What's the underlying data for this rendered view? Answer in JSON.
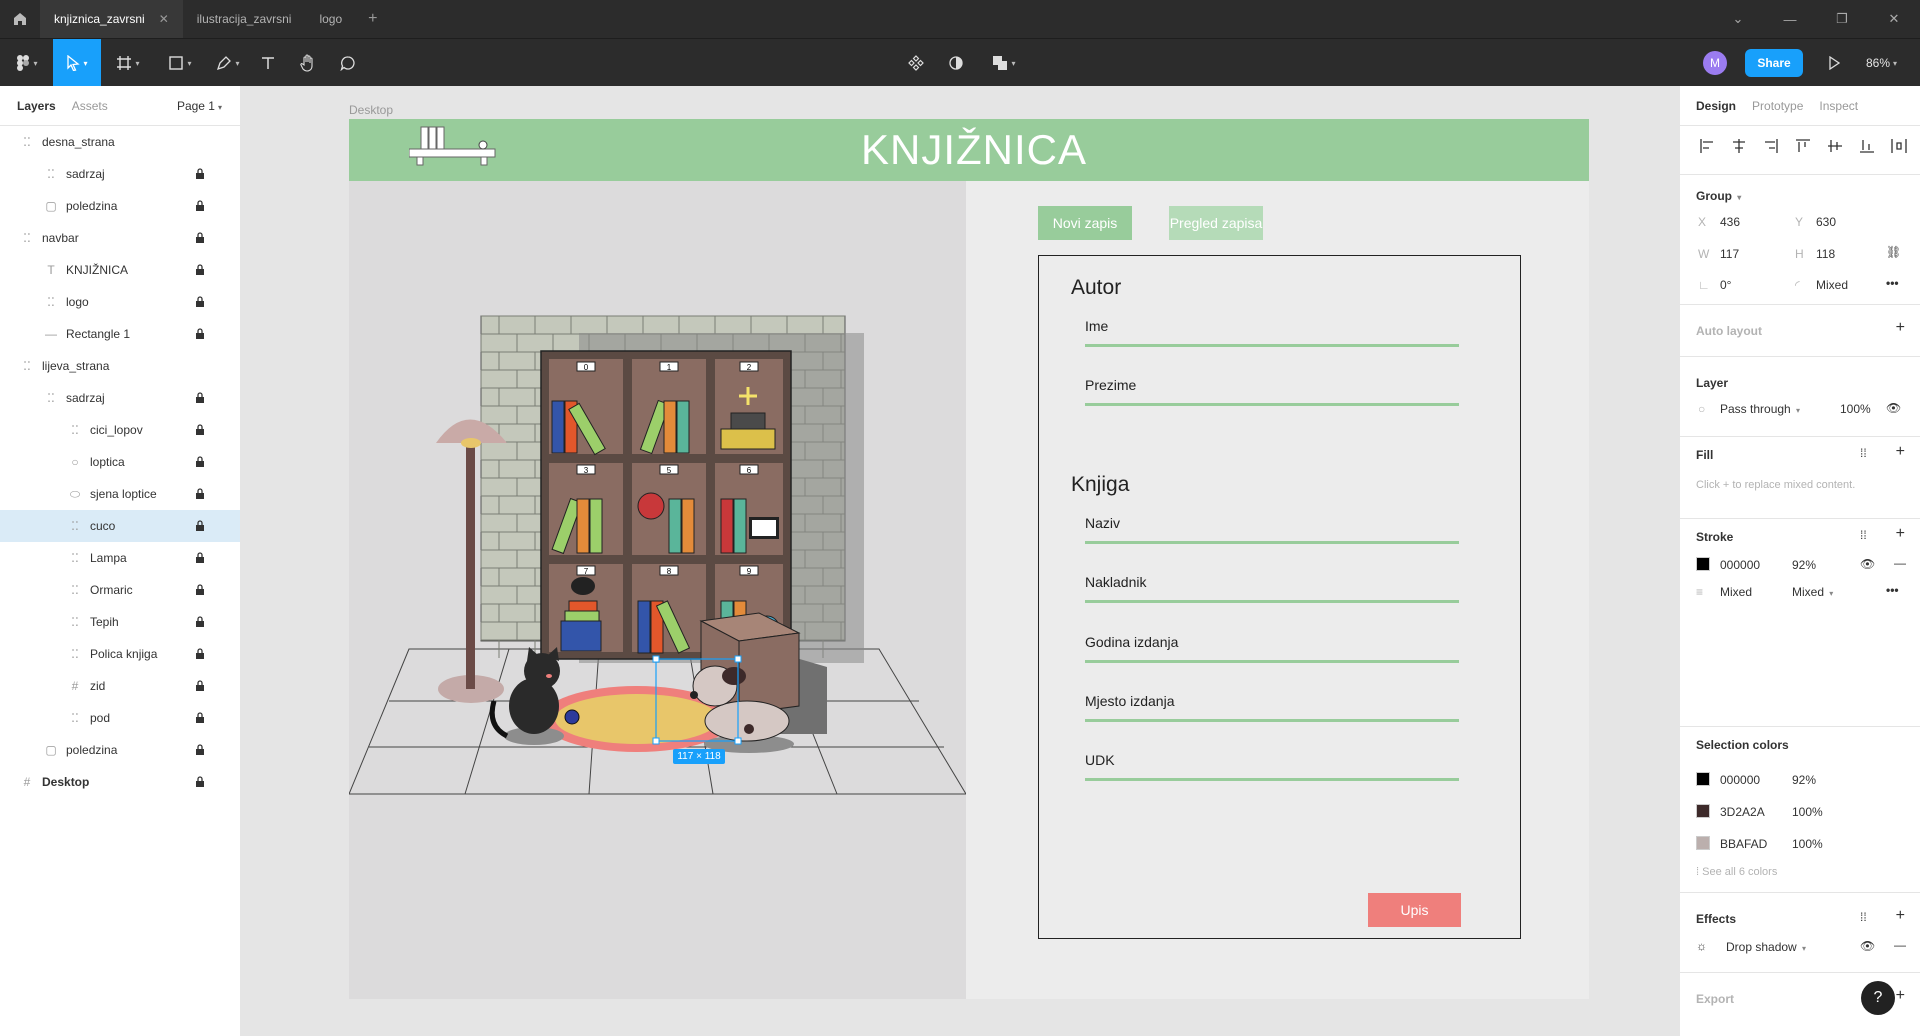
{
  "tabs": [
    {
      "label": "knjiznica_zavrsni",
      "active": true
    },
    {
      "label": "ilustracija_zavrsni",
      "active": false
    },
    {
      "label": "logo",
      "active": false
    }
  ],
  "toolbar": {
    "share_label": "Share",
    "zoom": "86%",
    "avatar_letter": "M"
  },
  "left_panel": {
    "tab_layers": "Layers",
    "tab_assets": "Assets",
    "page": "Page 1",
    "layers": [
      {
        "name": "desna_strana",
        "icon": "frame",
        "indent": 0,
        "locked": false
      },
      {
        "name": "sadrzaj",
        "icon": "frame",
        "indent": 1,
        "locked": true
      },
      {
        "name": "poledzina",
        "icon": "rect",
        "indent": 1,
        "locked": true
      },
      {
        "name": "navbar",
        "icon": "frame",
        "indent": 0,
        "locked": true
      },
      {
        "name": "KNJIŽNICA",
        "icon": "text",
        "indent": 1,
        "locked": true
      },
      {
        "name": "logo",
        "icon": "frame",
        "indent": 1,
        "locked": true
      },
      {
        "name": "Rectangle 1",
        "icon": "line",
        "indent": 1,
        "locked": true
      },
      {
        "name": "lijeva_strana",
        "icon": "frame",
        "indent": 0,
        "locked": false
      },
      {
        "name": "sadrzaj",
        "icon": "frame",
        "indent": 1,
        "locked": true
      },
      {
        "name": "cici_lopov",
        "icon": "frame",
        "indent": 2,
        "locked": true
      },
      {
        "name": "loptica",
        "icon": "circle",
        "indent": 2,
        "locked": true
      },
      {
        "name": "sjena loptice",
        "icon": "ellipse",
        "indent": 2,
        "locked": true
      },
      {
        "name": "cuco",
        "icon": "frame",
        "indent": 2,
        "locked": true,
        "selected": true
      },
      {
        "name": "Lampa",
        "icon": "frame",
        "indent": 2,
        "locked": true
      },
      {
        "name": "Ormaric",
        "icon": "frame",
        "indent": 2,
        "locked": true
      },
      {
        "name": "Tepih",
        "icon": "frame",
        "indent": 2,
        "locked": true
      },
      {
        "name": "Polica knjiga",
        "icon": "frame",
        "indent": 2,
        "locked": true
      },
      {
        "name": "zid",
        "icon": "hash",
        "indent": 2,
        "locked": true
      },
      {
        "name": "pod",
        "icon": "frame",
        "indent": 2,
        "locked": true
      },
      {
        "name": "poledzina",
        "icon": "rect",
        "indent": 1,
        "locked": true
      },
      {
        "name": "Desktop",
        "icon": "hash",
        "indent": 0,
        "locked": true
      }
    ]
  },
  "canvas": {
    "frame_label": "Desktop",
    "title": "KNJIŽNICA",
    "btn_new": "Novi zapis",
    "btn_view": "Pregled zapisa",
    "form": {
      "h_author": "Autor",
      "f_name": "Ime",
      "f_surname": "Prezime",
      "h_book": "Knjiga",
      "f_title": "Naziv",
      "f_publisher": "Nakladnik",
      "f_year": "Godina izdanja",
      "f_place": "Mjesto izdanja",
      "f_udk": "UDK",
      "btn_submit": "Upis"
    },
    "selection_size": "117 × 118",
    "shelf_numbers": [
      "0",
      "1",
      "2",
      "3",
      "5",
      "6",
      "7",
      "8",
      "9"
    ]
  },
  "right_panel": {
    "tab_design": "Design",
    "tab_prototype": "Prototype",
    "tab_inspect": "Inspect",
    "group_label": "Group",
    "x_label": "X",
    "x": "436",
    "y_label": "Y",
    "y": "630",
    "w_label": "W",
    "w": "117",
    "h_label": "H",
    "h": "118",
    "rotation": "0°",
    "radius": "Mixed",
    "auto_layout": "Auto layout",
    "layer_title": "Layer",
    "blend": "Pass through",
    "layer_opacity": "100%",
    "fill_title": "Fill",
    "fill_hint": "Click + to replace mixed content.",
    "stroke_title": "Stroke",
    "stroke_color": "000000",
    "stroke_opacity": "92%",
    "stroke_weight": "Mixed",
    "stroke_align": "Mixed",
    "sel_colors_title": "Selection colors",
    "sel_colors": [
      {
        "hex": "000000",
        "opacity": "92%",
        "swatch": "#000000"
      },
      {
        "hex": "3D2A2A",
        "opacity": "100%",
        "swatch": "#3d2a2a"
      },
      {
        "hex": "BBAFAD",
        "opacity": "100%",
        "swatch": "#bbafad"
      }
    ],
    "see_all": "See all 6 colors",
    "effects_title": "Effects",
    "effect": "Drop shadow",
    "export_title": "Export"
  },
  "help": "?"
}
